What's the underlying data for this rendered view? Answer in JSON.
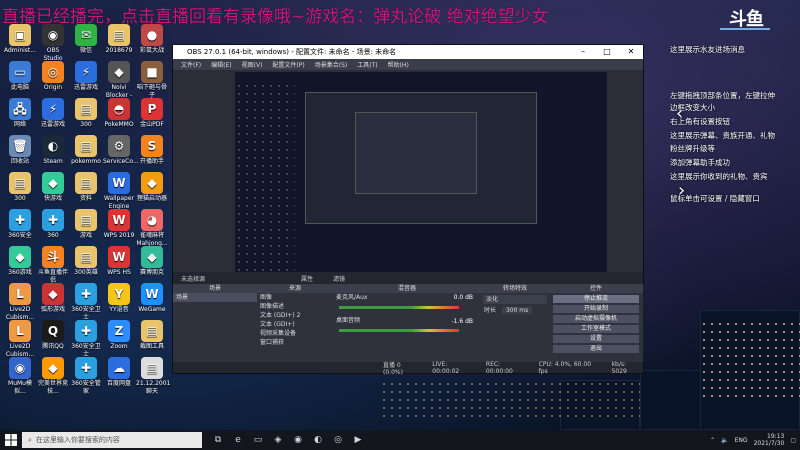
{
  "banner": {
    "text": "直播已经播完，点击直播回看有录像哦~游戏名：弹丸论破 绝对绝望少女"
  },
  "logo": {
    "text": "斗鱼"
  },
  "desktop_icons": [
    {
      "label": "Administ...",
      "glyph": "▣",
      "color": "#e9c46a"
    },
    {
      "label": "OBS Studio",
      "glyph": "◉",
      "color": "#333"
    },
    {
      "label": "微信",
      "glyph": "✉",
      "color": "#2fb344"
    },
    {
      "label": "2018679",
      "glyph": "▤",
      "color": "#e9c46a"
    },
    {
      "label": "彩鼠大战",
      "glyph": "●",
      "color": "#c04848"
    },
    {
      "label": "此电脑",
      "glyph": "▭",
      "color": "#3a7bd5"
    },
    {
      "label": "Origin",
      "glyph": "◎",
      "color": "#f58220"
    },
    {
      "label": "迅雷游戏",
      "glyph": "⚡",
      "color": "#2b6cdf"
    },
    {
      "label": "Noivi Blocker - ...",
      "glyph": "◆",
      "color": "#555"
    },
    {
      "label": "咱下砸与骨子",
      "glyph": "■",
      "color": "#8b5e3c"
    },
    {
      "label": "网络",
      "glyph": "🖧",
      "color": "#3a7bd5"
    },
    {
      "label": "迅雷游戏",
      "glyph": "⚡",
      "color": "#2b6cdf"
    },
    {
      "label": "300",
      "glyph": "▤",
      "color": "#e9c46a"
    },
    {
      "label": "PokeMMO",
      "glyph": "◓",
      "color": "#c33"
    },
    {
      "label": "金山PDF",
      "glyph": "P",
      "color": "#d33"
    },
    {
      "label": "回收站",
      "glyph": "🗑",
      "color": "#6a8bb5"
    },
    {
      "label": "Steam",
      "glyph": "◐",
      "color": "#1b2838"
    },
    {
      "label": "pokemmo",
      "glyph": "▤",
      "color": "#e9c46a"
    },
    {
      "label": "ServiceCo...",
      "glyph": "⚙",
      "color": "#666"
    },
    {
      "label": "开播助手",
      "glyph": "S",
      "color": "#f58220"
    },
    {
      "label": "300",
      "glyph": "▤",
      "color": "#e9c46a"
    },
    {
      "label": "快游戏",
      "glyph": "◆",
      "color": "#3c9"
    },
    {
      "label": "资料",
      "glyph": "▤",
      "color": "#e9c46a"
    },
    {
      "label": "Wallpaper Engine",
      "glyph": "W",
      "color": "#2b6cdf"
    },
    {
      "label": "狸猫启动器",
      "glyph": "◆",
      "color": "#f39c12"
    },
    {
      "label": "360安全",
      "glyph": "✚",
      "color": "#2b9fdf"
    },
    {
      "label": "360",
      "glyph": "✚",
      "color": "#2b9fdf"
    },
    {
      "label": "游戏",
      "glyph": "▤",
      "color": "#e9c46a"
    },
    {
      "label": "WPS 2019",
      "glyph": "W",
      "color": "#d33"
    },
    {
      "label": "雀魂麻将 Mahjong...",
      "glyph": "◕",
      "color": "#e66"
    },
    {
      "label": "360游戏",
      "glyph": "◆",
      "color": "#3c9"
    },
    {
      "label": "斗鱼直播伴侣",
      "glyph": "斗",
      "color": "#f58220"
    },
    {
      "label": "300英雄",
      "glyph": "▤",
      "color": "#e9c46a"
    },
    {
      "label": "WPS HS",
      "glyph": "W",
      "color": "#d33"
    },
    {
      "label": "赛博朋克",
      "glyph": "◆",
      "color": "#3b9"
    },
    {
      "label": "Live2D Cubism...",
      "glyph": "L",
      "color": "#e94"
    },
    {
      "label": "弧形游戏",
      "glyph": "◆",
      "color": "#c33"
    },
    {
      "label": "360安全卫士",
      "glyph": "✚",
      "color": "#2b9fdf"
    },
    {
      "label": "YY语音",
      "glyph": "Y",
      "color": "#f5c518"
    },
    {
      "label": "WeGame",
      "glyph": "W",
      "color": "#1e90ff"
    },
    {
      "label": "Live2D Cubism...",
      "glyph": "L",
      "color": "#e94"
    },
    {
      "label": "腾讯QQ",
      "glyph": "Q",
      "color": "#1b1b1b"
    },
    {
      "label": "360安全卫士",
      "glyph": "✚",
      "color": "#2b9fdf"
    },
    {
      "label": "Zoom",
      "glyph": "Z",
      "color": "#2d8cff"
    },
    {
      "label": "截图工具",
      "glyph": "▤",
      "color": "#e9c46a"
    },
    {
      "label": "MuMu模拟...",
      "glyph": "◉",
      "color": "#36c"
    },
    {
      "label": "完美世界竞技...",
      "glyph": "◆",
      "color": "#f90"
    },
    {
      "label": "360安全管家",
      "glyph": "✚",
      "color": "#2b9fdf"
    },
    {
      "label": "百度网盘",
      "glyph": "☁",
      "color": "#2b6cdf"
    },
    {
      "label": "21.12.2001 聊天",
      "glyph": "▤",
      "color": "#ddd"
    }
  ],
  "obs": {
    "title": "OBS 27.0.1 (64-bit, windows) - 配置文件: 未命名 - 场景: 未命名",
    "menu": [
      "文件(F)",
      "编辑(E)",
      "视图(V)",
      "配置文件(P)",
      "场景集合(S)",
      "工具(T)",
      "帮助(H)"
    ],
    "no_source": "未选择源",
    "props_btn": "属性",
    "filters_btn": "滤镜",
    "docks": {
      "scenes": {
        "title": "场景",
        "items": [
          "场景"
        ]
      },
      "sources": {
        "title": "来源",
        "items": [
          "图像",
          "图像描述",
          "文本 (GDI+) 2",
          "文本 (GDI+)",
          "视频采集设备",
          "窗口捕获"
        ]
      },
      "mixer": {
        "title": "混音器",
        "tracks": [
          {
            "name": "麦克风/Aux",
            "db": "0.0 dB"
          },
          {
            "name": "桌面音频",
            "db": "-1.6 dB"
          }
        ]
      },
      "transitions": {
        "title": "转场特效",
        "type": "淡化",
        "duration_label": "时长",
        "duration": "300 ms"
      },
      "controls": {
        "title": "控件",
        "buttons": [
          "停止推流",
          "开始录制",
          "启动虚拟摄像机",
          "工作室模式",
          "设置",
          "退出"
        ]
      }
    },
    "status": {
      "live": "直播 0 (0.0%)",
      "live_time": "LIVE: 00:00:02",
      "rec": "REC: 00:00:00",
      "cpu": "CPU: 4.0%, 60.00 fps",
      "kbps": "kb/s: 5029"
    }
  },
  "right_panel": {
    "top": "这里展示水友进场消息",
    "lines": [
      "左键拖拽顶部条位置，左键拉伸",
      "边框改变大小",
      "右上角有设置按钮",
      "这里展示弹幕、贵族开通、礼物",
      "粉丝牌升级等",
      "添加弹幕助手成功",
      "这里展示你收到的礼物、贵宾",
      "鼠标单击可设置 / 隐藏窗口"
    ],
    "arrows": [
      "‹",
      "›"
    ]
  },
  "taskbar": {
    "search_placeholder": "在这里输入你要搜索的内容",
    "icons": [
      "task-view-icon",
      "edge-icon",
      "file-explorer-icon",
      "store-icon",
      "obs-icon",
      "steam-icon",
      "chrome-icon",
      "player-icon"
    ],
    "tray_lang": "ENG",
    "time": "19:13",
    "date": "2021/7/30"
  }
}
